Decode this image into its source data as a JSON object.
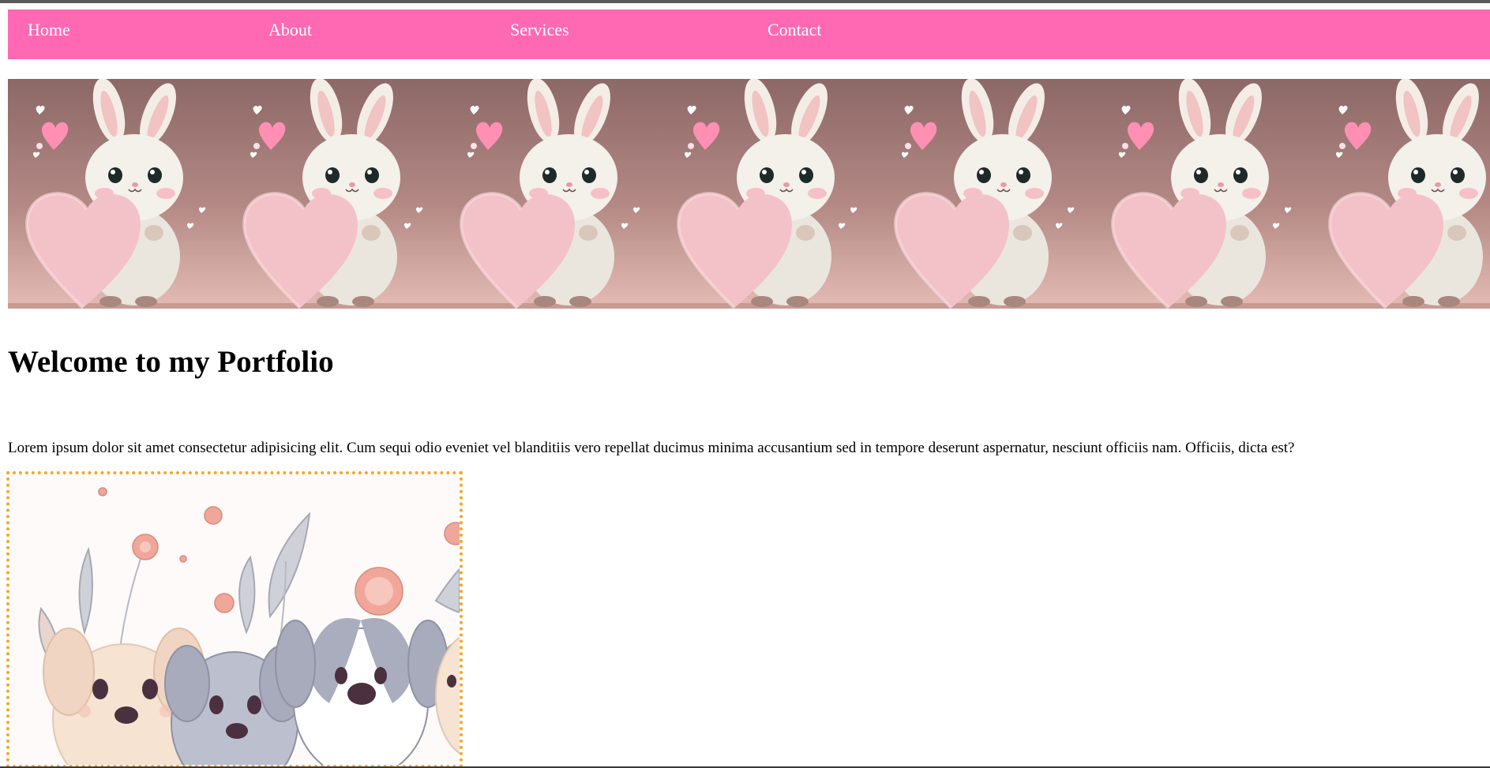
{
  "nav": {
    "items": [
      {
        "label": "Home"
      },
      {
        "label": "About"
      },
      {
        "label": "Services"
      },
      {
        "label": "Contact"
      }
    ],
    "background_color": "#ff69b4",
    "text_color": "#ffffff"
  },
  "banner": {
    "image": "bunny-with-heart-pattern",
    "tile_count": 7
  },
  "main": {
    "title": "Welcome to my Portfolio",
    "intro": "Lorem ipsum dolor sit amet consectetur adipisicing elit. Cum sequi odio eveniet vel blanditiis vero repellat ducimus minima accusantium sed in tempore deserunt aspernatur, nesciunt officiis nam. Officiis, dicta est?"
  },
  "feature_image": {
    "image": "cute-puppies-with-flowers-illustration",
    "border_color": "#f6a623"
  }
}
